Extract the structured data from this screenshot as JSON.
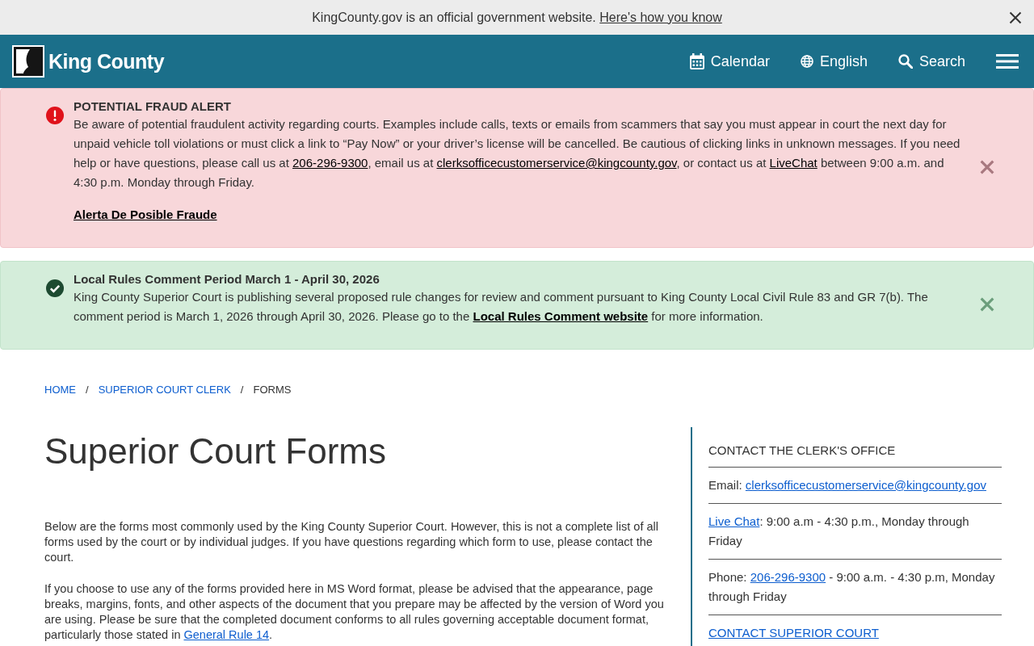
{
  "gov_banner": {
    "text": "KingCounty.gov is an official government website.",
    "link": "Here's how you know"
  },
  "header": {
    "site_name": "King County",
    "nav": [
      {
        "kind": "calendar",
        "label": "Calendar"
      },
      {
        "kind": "language",
        "label": "English"
      },
      {
        "kind": "search",
        "label": "Search"
      }
    ]
  },
  "alerts": [
    {
      "kind": "danger",
      "title": "POTENTIAL FRAUD ALERT",
      "paragraphs": [
        {
          "segments": [
            {
              "kind": "text",
              "text": "Be aware of potential fraudulent activity regarding courts. Examples include calls, texts or emails from scammers that say you must appear in court the next day for unpaid vehicle toll violations or must click a link to “Pay Now” or your driver’s license will be cancelled. Be cautious of clicking links in unknown messages. If you need help or have questions, please call us at "
            },
            {
              "kind": "link",
              "text": "206-296-9300"
            },
            {
              "kind": "text",
              "text": ", email us at "
            },
            {
              "kind": "link",
              "text": "clerksofficecustomerservice@kingcounty.gov"
            },
            {
              "kind": "text",
              "text": ", or contact us at "
            },
            {
              "kind": "link",
              "text": "LiveChat"
            },
            {
              "kind": "text",
              "text": " between 9:00 a.m. and 4:30 p.m. Monday through Friday."
            }
          ]
        },
        {
          "segments": [
            {
              "kind": "bold-link",
              "text": "Alerta De Posible Fraude"
            }
          ]
        }
      ]
    },
    {
      "kind": "success",
      "title": "Local Rules Comment Period March 1 - April 30, 2026",
      "paragraphs": [
        {
          "segments": [
            {
              "kind": "text",
              "text": "King County Superior Court is publishing several proposed rule changes for review and comment pursuant to King County Local Civil Rule 83 and GR 7(b). The comment period is March 1, 2026 through April 30, 2026. Please go to the "
            },
            {
              "kind": "bold-link",
              "text": "Local Rules Comment website"
            },
            {
              "kind": "text",
              "text": " for more information."
            }
          ]
        }
      ]
    }
  ],
  "breadcrumb": [
    {
      "label": "HOME",
      "current": false,
      "separator": "/"
    },
    {
      "label": "SUPERIOR COURT CLERK",
      "current": false,
      "separator": "/"
    },
    {
      "label": "FORMS",
      "current": true
    }
  ],
  "page_title": "Superior Court Forms",
  "paragraphs": [
    {
      "segments": [
        {
          "kind": "text",
          "text": "Below are the forms most commonly used by the King County Superior Court. However, this is not a complete list of all forms used by the court or by individual judges. If you have questions regarding which form to use, please contact the court."
        }
      ]
    },
    {
      "segments": [
        {
          "kind": "text",
          "text": "If you choose to use any of the forms provided here in MS Word format, please be advised that the appearance, page breaks, margins, fonts, and other aspects of the document that you prepare may be affected by the version of Word you are using. Please be sure that the completed document conforms to all rules governing acceptable document format, particularly those stated in "
        },
        {
          "kind": "link",
          "text": "General Rule 14"
        },
        {
          "kind": "text",
          "text": "."
        }
      ]
    }
  ],
  "sidebar": {
    "title": "CONTACT THE CLERK'S OFFICE",
    "items": [
      {
        "segments": [
          {
            "kind": "text",
            "text": "Email: "
          },
          {
            "kind": "link",
            "text": "clerksofficecustomerservice@kingcounty.gov"
          }
        ]
      },
      {
        "segments": [
          {
            "kind": "link",
            "text": "Live Chat"
          },
          {
            "kind": "text",
            "text": ": 9:00 a.m - 4:30 p.m., Monday through Friday"
          }
        ]
      },
      {
        "segments": [
          {
            "kind": "text",
            "text": "Phone: "
          },
          {
            "kind": "link",
            "text": "206-296-9300"
          },
          {
            "kind": "text",
            "text": " - 9:00 a.m. - 4:30 p.m, Monday through Friday"
          }
        ]
      },
      {
        "segments": [
          {
            "kind": "link",
            "text": "CONTACT SUPERIOR COURT"
          }
        ]
      }
    ]
  }
}
